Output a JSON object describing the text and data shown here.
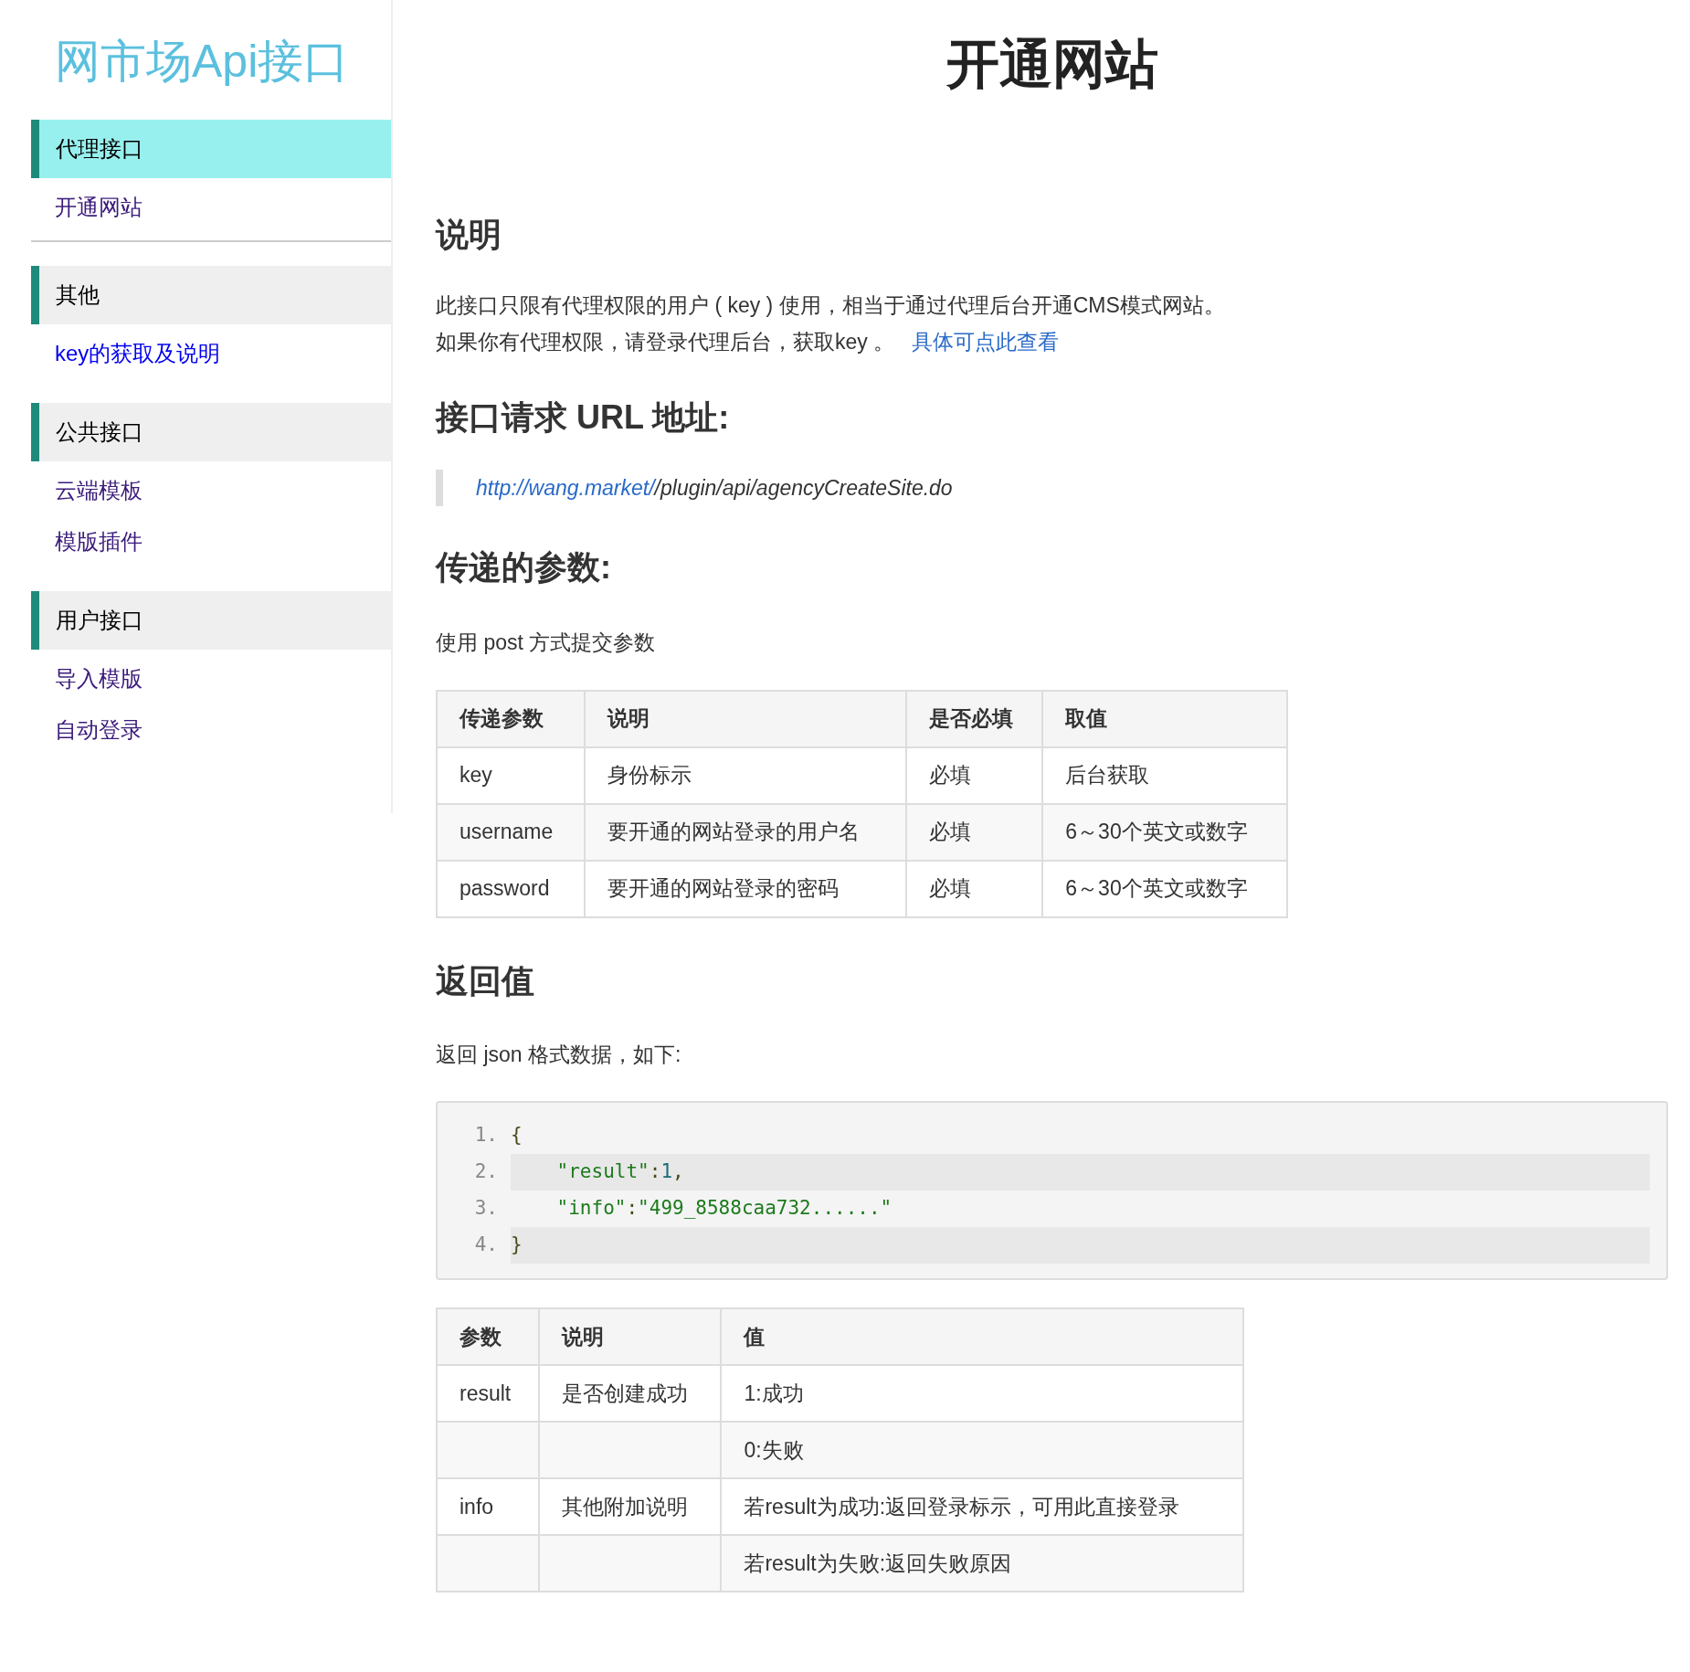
{
  "sidebar": {
    "title": "网市场Api接口",
    "sections": [
      {
        "heading": "代理接口",
        "selected": true,
        "divider": true,
        "items": [
          {
            "label": "开通网站",
            "visited": true
          }
        ]
      },
      {
        "heading": "其他",
        "selected": false,
        "divider": false,
        "items": [
          {
            "label": "key的获取及说明",
            "visited": false
          }
        ]
      },
      {
        "heading": "公共接口",
        "selected": false,
        "divider": false,
        "items": [
          {
            "label": "云端模板",
            "visited": true
          },
          {
            "label": "模版插件",
            "visited": true
          }
        ]
      },
      {
        "heading": "用户接口",
        "selected": false,
        "divider": false,
        "items": [
          {
            "label": "导入模版",
            "visited": true
          },
          {
            "label": "自动登录",
            "visited": true
          }
        ]
      }
    ]
  },
  "page_title": "开通网站",
  "intro": {
    "heading": "说明",
    "line_1": "此接口只限有代理权限的用户 ( key ) 使用，相当于通过代理后台开通CMS模式网站。",
    "line_2": "如果你有代理权限，请登录代理后台，获取key 。",
    "link": "具体可点此查看"
  },
  "url_section": {
    "heading": "接口请求 URL 地址:",
    "link": "http://wang.market/",
    "path": "/plugin/api/agencyCreateSite.do"
  },
  "params_section": {
    "heading": "传递的参数:",
    "note": "使用 post 方式提交参数"
  },
  "params_table": {
    "columns": [
      "传递参数",
      "说明",
      "是否必填",
      "取值"
    ],
    "rows": [
      [
        "key",
        "身份标示",
        "必填",
        "后台获取"
      ],
      [
        "username",
        "要开通的网站登录的用户名",
        "必填",
        "6～30个英文或数字"
      ],
      [
        "password",
        "要开通的网站登录的密码",
        "必填",
        "6～30个英文或数字"
      ]
    ]
  },
  "return_section": {
    "heading": "返回值",
    "note": "返回 json 格式数据，如下:"
  },
  "code": [
    {
      "number": "1.",
      "tokens": [
        {
          "kind": "punct",
          "text": "{"
        }
      ]
    },
    {
      "number": "2.",
      "tokens": [
        {
          "kind": "string",
          "text": "\"result\""
        },
        {
          "kind": "punct",
          "text": ":"
        },
        {
          "kind": "number",
          "text": "1"
        },
        {
          "kind": "punct",
          "text": ","
        }
      ]
    },
    {
      "number": "3.",
      "tokens": [
        {
          "kind": "string",
          "text": "\"info\""
        },
        {
          "kind": "punct",
          "text": ":"
        },
        {
          "kind": "string",
          "text": "\"499_8588caa732......\""
        }
      ]
    },
    {
      "number": "4.",
      "tokens": [
        {
          "kind": "punct",
          "text": "}"
        }
      ]
    }
  ],
  "return_table": {
    "columns": [
      "参数",
      "说明",
      "值"
    ],
    "rows": [
      [
        "result",
        "是否创建成功",
        "1:成功"
      ],
      [
        null,
        null,
        "0:失败"
      ],
      [
        "info",
        "其他附加说明",
        "若result为成功:返回登录标示，可用此直接登录"
      ],
      [
        null,
        null,
        "若result为失败:返回失败原因"
      ]
    ]
  }
}
